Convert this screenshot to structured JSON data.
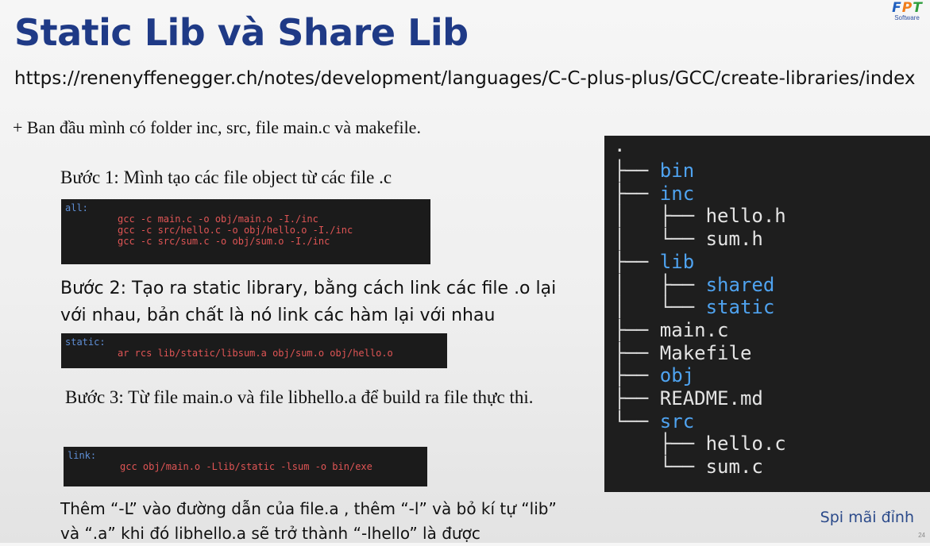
{
  "slide": {
    "title": "Static Lib và Share Lib",
    "url": "https://renenyffenegger.ch/notes/development/languages/C-C-plus-plus/GCC/create-libraries/index",
    "intro": "+ Ban đầu mình có folder inc, src, file main.c và makefile.",
    "step1": "Bước 1: Mình tạo các file object từ các file .c",
    "step2": "Bước 2: Tạo ra static library, bằng cách link các file .o lại với nhau, bản chất là nó link các hàm lại với nhau",
    "step3": "Bước 3: Từ file main.o và file libhello.a để build ra file thực thi.",
    "note_line1": "Thêm “-L” vào đường dẫn của file.a , thêm “-l” và bỏ kí tự “lib”",
    "note_line2": "và “.a” khi đó libhello.a sẽ trở thành “-lhello” là được",
    "brand_text": "Spi mãi đỉnh",
    "page_number": "24"
  },
  "logo": {
    "letters": [
      "F",
      "P",
      "T"
    ],
    "letter_colors": [
      "#1f5fbf",
      "#f07d1a",
      "#2e9e3e"
    ],
    "sub": "Software"
  },
  "code_blocks": {
    "all": {
      "label": "all:",
      "lines": [
        "gcc -c main.c -o obj/main.o -I./inc",
        "gcc -c src/hello.c -o obj/hello.o -I./inc",
        "gcc -c src/sum.c -o obj/sum.o -I./inc"
      ]
    },
    "static": {
      "label": "static:",
      "lines": [
        "ar rcs lib/static/libsum.a obj/sum.o obj/hello.o"
      ]
    },
    "link": {
      "label": "link:",
      "lines": [
        "gcc obj/main.o -Llib/static -lsum -o bin/exe"
      ]
    }
  },
  "tree": {
    "root": ".",
    "items": [
      {
        "prefix": "├── ",
        "name": "bin",
        "is_dir": true
      },
      {
        "prefix": "├── ",
        "name": "inc",
        "is_dir": true
      },
      {
        "prefix": "│   ├── ",
        "name": "hello.h",
        "is_dir": false
      },
      {
        "prefix": "│   └── ",
        "name": "sum.h",
        "is_dir": false
      },
      {
        "prefix": "├── ",
        "name": "lib",
        "is_dir": true
      },
      {
        "prefix": "│   ├── ",
        "name": "shared",
        "is_dir": true
      },
      {
        "prefix": "│   └── ",
        "name": "static",
        "is_dir": true
      },
      {
        "prefix": "├── ",
        "name": "main.c",
        "is_dir": false
      },
      {
        "prefix": "├── ",
        "name": "Makefile",
        "is_dir": false
      },
      {
        "prefix": "├── ",
        "name": "obj",
        "is_dir": true
      },
      {
        "prefix": "├── ",
        "name": "README.md",
        "is_dir": false
      },
      {
        "prefix": "└── ",
        "name": "src",
        "is_dir": true
      },
      {
        "prefix": "    ├── ",
        "name": "hello.c",
        "is_dir": false
      },
      {
        "prefix": "    └── ",
        "name": "sum.c",
        "is_dir": false
      }
    ]
  },
  "colors": {
    "title": "#1f3a86",
    "code_text": "#e05555",
    "code_label": "#5f8fd6",
    "tree_dir": "#4fa3f0",
    "brand_text": "#2b4a8a"
  }
}
